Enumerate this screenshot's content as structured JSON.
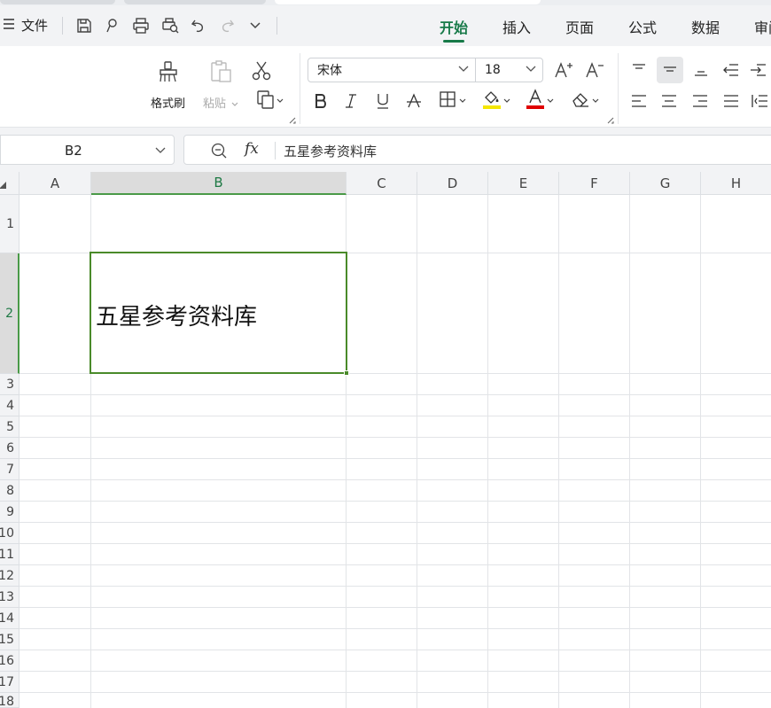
{
  "menubar": {
    "file_label": "文件",
    "tabs": [
      "开始",
      "插入",
      "页面",
      "公式",
      "数据",
      "审阅"
    ],
    "active_tab": "开始"
  },
  "ribbon": {
    "format_painter_label": "格式刷",
    "paste_label": "粘贴",
    "font_name": "宋体",
    "font_size": "18"
  },
  "formula_bar": {
    "cell_ref": "B2",
    "fx_label": "fx",
    "content": "五星参考资料库"
  },
  "sheet": {
    "columns": [
      "A",
      "B",
      "C",
      "D",
      "E",
      "F",
      "G",
      "H"
    ],
    "selected_column": "B",
    "rows": [
      "1",
      "2",
      "3",
      "4",
      "5",
      "6",
      "7",
      "8",
      "9",
      "10",
      "11",
      "12",
      "13",
      "14",
      "15",
      "16",
      "17",
      "18"
    ],
    "selected_row": "2",
    "cells": {
      "B2": "五星参考资料库"
    }
  },
  "colors": {
    "accent": "#187a49",
    "selection": "#4a8a2a",
    "font_color_bar": "#e00000",
    "highlight_bar": "#f5e600"
  }
}
